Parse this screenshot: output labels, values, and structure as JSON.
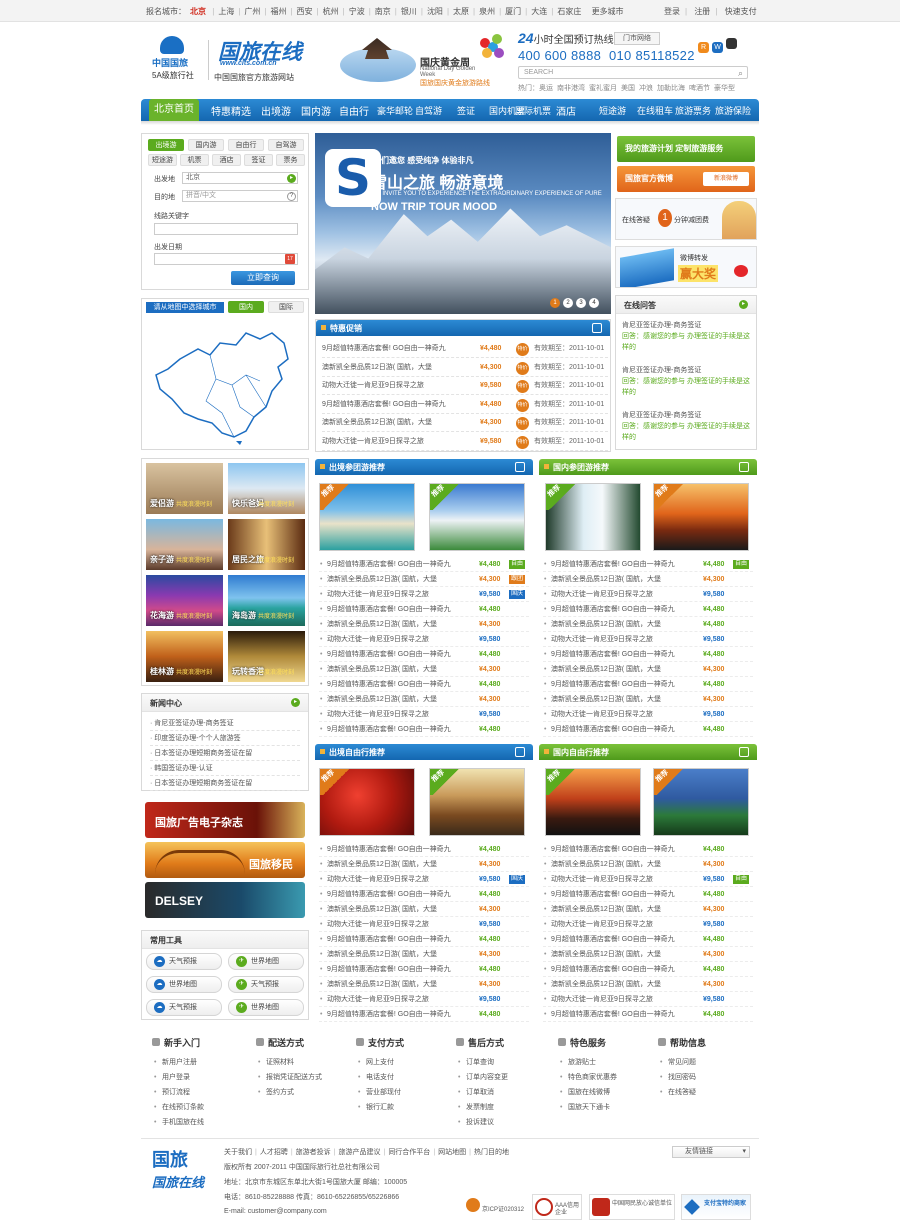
{
  "topbar": {
    "city_label": "报名城市：",
    "current_city": "北京",
    "cities": [
      "上海",
      "广州",
      "福州",
      "西安",
      "杭州",
      "宁波",
      "南京",
      "银川",
      "沈阳",
      "太原",
      "泉州",
      "厦门",
      "大连",
      "石家庄"
    ],
    "more": "更多城市",
    "links": [
      "登录",
      "注册",
      "快速支付"
    ]
  },
  "header": {
    "logo1_text": "中国国旅",
    "logo1_sub": "5A级旅行社",
    "logo2_big": "国旅在线",
    "logo2_url": "www.cits.com.cn",
    "logo2_sub": "中国国旅官方旅游网站",
    "promo_cn": "国庆黄金周",
    "promo_en1": "National Day Golden",
    "promo_en2": "Week",
    "promo_sub": "国旅国庆黄金旅游路线",
    "hotline_hours": "24",
    "hotline_label": "小时全国预订热线",
    "city_hotline_btn": "门市网络",
    "phone1": "400 600 8888",
    "phone2": "010 85118522",
    "search_placeholder": "SEARCH",
    "hot_label": "热门：",
    "hot_words": [
      "奥运",
      "南非港湾",
      "蜜礼蜜月",
      "美国",
      "冲浪",
      "加勒比海",
      "啤酒节",
      "豪华型"
    ]
  },
  "nav": {
    "home": "北京首页",
    "items": [
      "特惠精选",
      "出境游",
      "国内游",
      "自由行",
      "豪华邮轮",
      "自驾游",
      "签证",
      "国内机票",
      "国际机票",
      "酒店",
      "短途游",
      "在线租车",
      "旅游票务",
      "旅游保险"
    ]
  },
  "search_box": {
    "tabs_row1": [
      "出境游",
      "国内游",
      "自由行",
      "自驾游"
    ],
    "tabs_row2": [
      "短途游",
      "机票",
      "酒店",
      "签证",
      "票务"
    ],
    "depart_label": "出发地",
    "depart_value": "北京",
    "dest_label": "目的地",
    "dest_placeholder": "拼音/中文",
    "keyword_label": "线路关键字",
    "date_label": "出发日期",
    "submit": "立即查询"
  },
  "map_box": {
    "title": "请从地图中选择城市",
    "tab_domestic": "国内",
    "tab_international": "国际"
  },
  "photo_grid": [
    {
      "label": "爱侣游",
      "sub": "共度浪漫时刻"
    },
    {
      "label": "快乐爸妈",
      "sub": "共度浪漫时刻"
    },
    {
      "label": "亲子游",
      "sub": "共度浪漫时刻"
    },
    {
      "label": "居民之旅",
      "sub": "共度浪漫时刻"
    },
    {
      "label": "花海游",
      "sub": "共度浪漫时刻"
    },
    {
      "label": "海岛游",
      "sub": "共度浪漫时刻"
    },
    {
      "label": "桂林游",
      "sub": "共度浪漫时刻"
    },
    {
      "label": "玩转香港",
      "sub": "共度浪漫时刻"
    }
  ],
  "news": {
    "title": "新闻中心",
    "items": [
      "肯尼亚签证办理-商务签证",
      "印度签证办理-个个人旅游签",
      "日本签证办理短期商务签证在留",
      "韩国签证办理-认证",
      "日本签证办理短期商务签证在留"
    ]
  },
  "ads": [
    "国旅广告电子杂志",
    "国旅移民",
    "DELSEY"
  ],
  "tools": {
    "title": "常用工具",
    "items": [
      "天气预报",
      "世界地图",
      "世界地图",
      "天气预报",
      "天气预报",
      "世界地图"
    ]
  },
  "banner": {
    "letter": "S",
    "cn1": "我们邀您 感受纯净 体验非凡",
    "cn2": "雪山之旅 畅游意境",
    "en1": "WE INVITE YOU TO EXPERIENCE THE EXTRAORDINARY EXPERIENCE OF PURE",
    "en2": "NOW TRIP TOUR MOOD",
    "dots": [
      "1",
      "2",
      "3",
      "4"
    ]
  },
  "promo": {
    "title": "特惠促销",
    "badge": "特价",
    "valid_label": "有效期至：",
    "rows": [
      {
        "name": "9月超值特惠酒店套餐! GO自由一神奇九",
        "price": "¥4,480",
        "date": "2011-10-01"
      },
      {
        "name": "澳新凯全景品质12日游( 国航，大堡",
        "price": "¥4,300",
        "date": "2011-10-01"
      },
      {
        "name": "动物大迁徙一肯尼亚9日探寻之旅",
        "price": "¥9,580",
        "date": "2011-10-01"
      },
      {
        "name": "9月超值特惠酒店套餐! GO自由一神奇九",
        "price": "¥4,480",
        "date": "2011-10-01"
      },
      {
        "name": "澳新凯全景品质12日游( 国航，大堡",
        "price": "¥4,300",
        "date": "2011-10-01"
      },
      {
        "name": "动物大迁徙一肯尼亚9日探寻之旅",
        "price": "¥9,580",
        "date": "2011-10-01"
      }
    ]
  },
  "right": {
    "btn1": "我的旅游计划  定制旅游服务",
    "btn2": "国旅官方微博",
    "btn2_tag": "新浪微博",
    "img1_text": "在线答疑",
    "img1_big": "1",
    "img1_tail": "分钟减团费",
    "img2_text": "微博转发",
    "img2_big": "赢大奖",
    "qa_title": "在线问答",
    "qa": [
      {
        "q": "肯尼亚签证办理-商务签证",
        "a": "回答：感谢您的参与 办理签证的手续是这样的"
      },
      {
        "q": "肯尼亚签证办理-商务签证",
        "a": "回答：感谢您的参与 办理签证的手续是这样的"
      },
      {
        "q": "肯尼亚签证办理-商务签证",
        "a": "回答：感谢您的参与 办理签证的手续是这样的"
      }
    ]
  },
  "panels": {
    "tag": "推荐",
    "tag_en": "RECOMMEND",
    "outbound_group": {
      "title": "出境参团游推荐",
      "rows": [
        {
          "name": "9月超值特惠酒店套餐! GO自由一神奇九",
          "price": "¥4,480",
          "badge": "自由"
        },
        {
          "name": "澳新凯全景品质12日游( 国航，大堡",
          "price": "¥4,300",
          "badge": "跟团"
        },
        {
          "name": "动物大迁徙一肯尼亚9日探寻之旅",
          "price": "¥9,580",
          "badge": "国庆"
        },
        {
          "name": "9月超值特惠酒店套餐! GO自由一神奇九",
          "price": "¥4,480",
          "badge": ""
        },
        {
          "name": "澳新凯全景品质12日游( 国航，大堡",
          "price": "¥4,300",
          "badge": ""
        },
        {
          "name": "动物大迁徙一肯尼亚9日探寻之旅",
          "price": "¥9,580",
          "badge": ""
        },
        {
          "name": "9月超值特惠酒店套餐! GO自由一神奇九",
          "price": "¥4,480",
          "badge": ""
        },
        {
          "name": "澳新凯全景品质12日游( 国航，大堡",
          "price": "¥4,300",
          "badge": ""
        },
        {
          "name": "9月超值特惠酒店套餐! GO自由一神奇九",
          "price": "¥4,480",
          "badge": ""
        },
        {
          "name": "澳新凯全景品质12日游( 国航，大堡",
          "price": "¥4,300",
          "badge": ""
        },
        {
          "name": "动物大迁徙一肯尼亚9日探寻之旅",
          "price": "¥9,580",
          "badge": ""
        },
        {
          "name": "9月超值特惠酒店套餐! GO自由一神奇九",
          "price": "¥4,480",
          "badge": ""
        }
      ]
    },
    "domestic_group": {
      "title": "国内参团游推荐",
      "rows": [
        {
          "name": "9月超值特惠酒店套餐! GO自由一神奇九",
          "price": "¥4,480",
          "badge": "自由"
        },
        {
          "name": "澳新凯全景品质12日游( 国航，大堡",
          "price": "¥4,300",
          "badge": ""
        },
        {
          "name": "动物大迁徙一肯尼亚9日探寻之旅",
          "price": "¥9,580",
          "badge": ""
        },
        {
          "name": "9月超值特惠酒店套餐! GO自由一神奇九",
          "price": "¥4,480",
          "badge": ""
        },
        {
          "name": "澳新凯全景品质12日游( 国航，大堡",
          "price": "¥4,480",
          "badge": ""
        },
        {
          "name": "动物大迁徙一肯尼亚9日探寻之旅",
          "price": "¥9,580",
          "badge": ""
        },
        {
          "name": "9月超值特惠酒店套餐! GO自由一神奇九",
          "price": "¥4,480",
          "badge": ""
        },
        {
          "name": "澳新凯全景品质12日游( 国航，大堡",
          "price": "¥4,300",
          "badge": ""
        },
        {
          "name": "9月超值特惠酒店套餐! GO自由一神奇九",
          "price": "¥4,480",
          "badge": ""
        },
        {
          "name": "澳新凯全景品质12日游( 国航，大堡",
          "price": "¥4,300",
          "badge": ""
        },
        {
          "name": "动物大迁徙一肯尼亚9日探寻之旅",
          "price": "¥9,580",
          "badge": ""
        },
        {
          "name": "9月超值特惠酒店套餐! GO自由一神奇九",
          "price": "¥4,480",
          "badge": ""
        }
      ]
    },
    "outbound_free": {
      "title": "出境自由行推荐",
      "rows": [
        {
          "name": "9月超值特惠酒店套餐! GO自由一神奇九",
          "price": "¥4,480",
          "badge": ""
        },
        {
          "name": "澳新凯全景品质12日游( 国航，大堡",
          "price": "¥4,300",
          "badge": ""
        },
        {
          "name": "动物大迁徙一肯尼亚9日探寻之旅",
          "price": "¥9,580",
          "badge": "国庆"
        },
        {
          "name": "9月超值特惠酒店套餐! GO自由一神奇九",
          "price": "¥4,480",
          "badge": ""
        },
        {
          "name": "澳新凯全景品质12日游( 国航，大堡",
          "price": "¥4,300",
          "badge": ""
        },
        {
          "name": "动物大迁徙一肯尼亚9日探寻之旅",
          "price": "¥9,580",
          "badge": ""
        },
        {
          "name": "9月超值特惠酒店套餐! GO自由一神奇九",
          "price": "¥4,480",
          "badge": ""
        },
        {
          "name": "澳新凯全景品质12日游( 国航，大堡",
          "price": "¥4,300",
          "badge": ""
        },
        {
          "name": "9月超值特惠酒店套餐! GO自由一神奇九",
          "price": "¥4,480",
          "badge": ""
        },
        {
          "name": "澳新凯全景品质12日游( 国航，大堡",
          "price": "¥4,300",
          "badge": ""
        },
        {
          "name": "动物大迁徙一肯尼亚9日探寻之旅",
          "price": "¥9,580",
          "badge": ""
        },
        {
          "name": "9月超值特惠酒店套餐! GO自由一神奇九",
          "price": "¥4,480",
          "badge": ""
        }
      ]
    },
    "domestic_free": {
      "title": "国内自由行推荐",
      "rows": [
        {
          "name": "9月超值特惠酒店套餐! GO自由一神奇九",
          "price": "¥4,480",
          "badge": ""
        },
        {
          "name": "澳新凯全景品质12日游( 国航，大堡",
          "price": "¥4,300",
          "badge": ""
        },
        {
          "name": "动物大迁徙一肯尼亚9日探寻之旅",
          "price": "¥9,580",
          "badge": "自由"
        },
        {
          "name": "9月超值特惠酒店套餐! GO自由一神奇九",
          "price": "¥4,480",
          "badge": ""
        },
        {
          "name": "澳新凯全景品质12日游( 国航，大堡",
          "price": "¥4,300",
          "badge": ""
        },
        {
          "name": "动物大迁徙一肯尼亚9日探寻之旅",
          "price": "¥9,580",
          "badge": ""
        },
        {
          "name": "9月超值特惠酒店套餐! GO自由一神奇九",
          "price": "¥4,480",
          "badge": ""
        },
        {
          "name": "澳新凯全景品质12日游( 国航，大堡",
          "price": "¥4,300",
          "badge": ""
        },
        {
          "name": "9月超值特惠酒店套餐! GO自由一神奇九",
          "price": "¥4,480",
          "badge": ""
        },
        {
          "name": "澳新凯全景品质12日游( 国航，大堡",
          "price": "¥4,300",
          "badge": ""
        },
        {
          "name": "动物大迁徙一肯尼亚9日探寻之旅",
          "price": "¥9,580",
          "badge": ""
        },
        {
          "name": "9月超值特惠酒店套餐! GO自由一神奇九",
          "price": "¥4,480",
          "badge": ""
        }
      ]
    }
  },
  "help": [
    {
      "title": "新手入门",
      "items": [
        "新用户注册",
        "用户登录",
        "预订流程",
        "在线预订条款",
        "手机国旅在线"
      ]
    },
    {
      "title": "配送方式",
      "items": [
        "证照材料",
        "报销凭证配送方式",
        "签约方式"
      ]
    },
    {
      "title": "支付方式",
      "items": [
        "网上支付",
        "电话支付",
        "营业部现付",
        "银行汇款"
      ]
    },
    {
      "title": "售后方式",
      "items": [
        "订单查询",
        "订单内容变更",
        "订单取消",
        "发票制度",
        "投诉建议"
      ]
    },
    {
      "title": "特色服务",
      "items": [
        "旅游贴士",
        "特色商家优惠券",
        "国旅在线微博",
        "国旅天下通卡"
      ]
    },
    {
      "title": "帮助信息",
      "items": [
        "常见问题",
        "找回密码",
        "在线答疑"
      ]
    }
  ],
  "footer": {
    "logo_a": "国旅",
    "logo_b": "国旅在线",
    "links": [
      "关于我们",
      "人才招聘",
      "旅游者投诉",
      "旅游产品建议",
      "同行合作平台",
      "网站地图",
      "热门目的地"
    ],
    "copyright": "版权所有  2007-2011  中国国际旅行社总社有限公司",
    "address": "地址：北京市东城区东单北大街1号国旅大厦   邮编：100005",
    "tel": "电话：8610-85228888   传真：8610-65226855/65226866",
    "email": "E-mail: customer@company.com",
    "friend_links": "友情链接",
    "icp": "京ICP证020312",
    "badge1": "AAA信用企业",
    "badge2": "中国网民放心诚信单位",
    "badge3": "支付宝特约商家"
  }
}
